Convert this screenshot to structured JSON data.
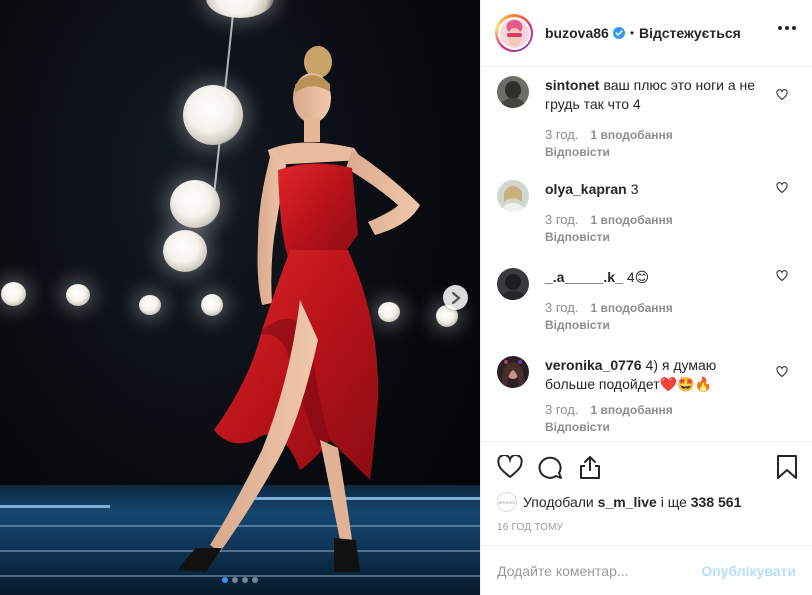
{
  "post": {
    "carousel_total": 4,
    "carousel_active": 1
  },
  "header": {
    "username": "buzova86",
    "separator": "•",
    "follow_status": "Відстежується"
  },
  "comments": [
    {
      "user": "sintonet",
      "text": "ваш плюс это ноги а не грудь так что 4",
      "time": "3 год.",
      "likes": "1 вподобання",
      "reply": "Відповісти"
    },
    {
      "user": "olya_kapran",
      "text": "3",
      "time": "3 год.",
      "likes": "1 вподобання",
      "reply": "Відповісти"
    },
    {
      "user": "_.a_____.k_",
      "text": "4😊",
      "time": "3 год.",
      "likes": "1 вподобання",
      "reply": "Відповісти"
    },
    {
      "user": "veronika_0776",
      "text": "4) я думаю больше подойдет❤️🤩🔥",
      "time": "3 год.",
      "likes": "1 вподобання",
      "reply": "Відповісти"
    }
  ],
  "likes": {
    "mini_avatar_text": "BROKEN",
    "prefix": "Уподобали",
    "user": "s_m_live",
    "joiner": "і ще",
    "count": "338 561"
  },
  "timestamp": "16 ГОД ТОМУ",
  "composer": {
    "placeholder": "Додайте коментар...",
    "publish": "Опублікувати"
  },
  "colors": {
    "accent_blue": "#3897f0",
    "publish_disabled": "#b2dffc",
    "dress_red": "#c8161c"
  }
}
